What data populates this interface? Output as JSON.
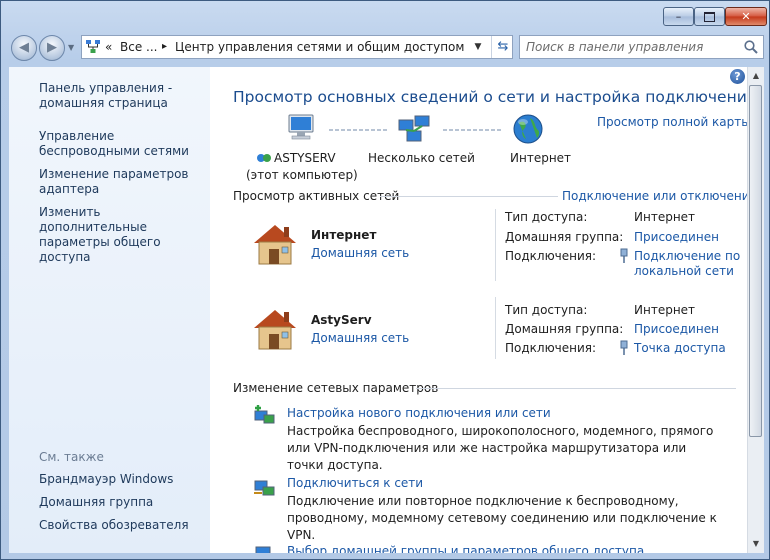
{
  "window": {
    "minimize": "–",
    "maximize": "",
    "close": "✕"
  },
  "nav": {
    "back_icon": "arrow-left-icon",
    "forward_icon": "arrow-right-icon"
  },
  "address": {
    "crumbs": [
      "«",
      "Все ...",
      "▸",
      "Центр управления сетями и общим доступом"
    ],
    "icon": "network-center-icon"
  },
  "search": {
    "placeholder": "Поиск в панели управления"
  },
  "sidebar": {
    "links": [
      "Панель управления - домашняя страница",
      "Управление беспроводными сетями",
      "Изменение параметров адаптера",
      "Изменить дополнительные параметры общего доступа"
    ],
    "see_also": "См. также",
    "see_also_links": [
      "Брандмауэр Windows",
      "Домашняя группа",
      "Свойства обозревателя"
    ]
  },
  "main": {
    "title": "Просмотр основных сведений о сети и настройка подключений",
    "full_map": "Просмотр полной карты",
    "map": {
      "computer": "ASTYSERV",
      "computer_sub": "(этот компьютер)",
      "middle": "Несколько сетей",
      "internet": "Интернет"
    },
    "active_title": "Просмотр активных сетей",
    "connect_disconnect": "Подключение или отключение",
    "networks": [
      {
        "name": "Интернет",
        "type_link": "Домашняя сеть",
        "access_label": "Тип доступа:",
        "access_value": "Интернет",
        "group_label": "Домашняя группа:",
        "group_value": "Присоединен",
        "conn_label": "Подключения:",
        "conn_value": "Подключение по локальной сети"
      },
      {
        "name": "AstyServ",
        "type_link": "Домашняя сеть",
        "access_label": "Тип доступа:",
        "access_value": "Интернет",
        "group_label": "Домашняя группа:",
        "group_value": "Присоединен",
        "conn_label": "Подключения:",
        "conn_value": "Точка доступа"
      }
    ],
    "change_title": "Изменение сетевых параметров",
    "tasks": [
      {
        "link": "Настройка нового подключения или сети",
        "desc": "Настройка беспроводного, широкополосного, модемного, прямого или VPN-подключения или же настройка маршрутизатора или точки доступа."
      },
      {
        "link": "Подключиться к сети",
        "desc": "Подключение или повторное подключение к беспроводному, проводному, модемному сетевому соединению или подключение к VPN."
      },
      {
        "link": "Выбор домашней группы и параметров общего доступа",
        "desc": ""
      }
    ]
  },
  "colors": {
    "link": "#1c58a6",
    "title": "#1b4c8e",
    "sidebar_bg": "#e3edf9",
    "chrome": "#b7cde9"
  }
}
